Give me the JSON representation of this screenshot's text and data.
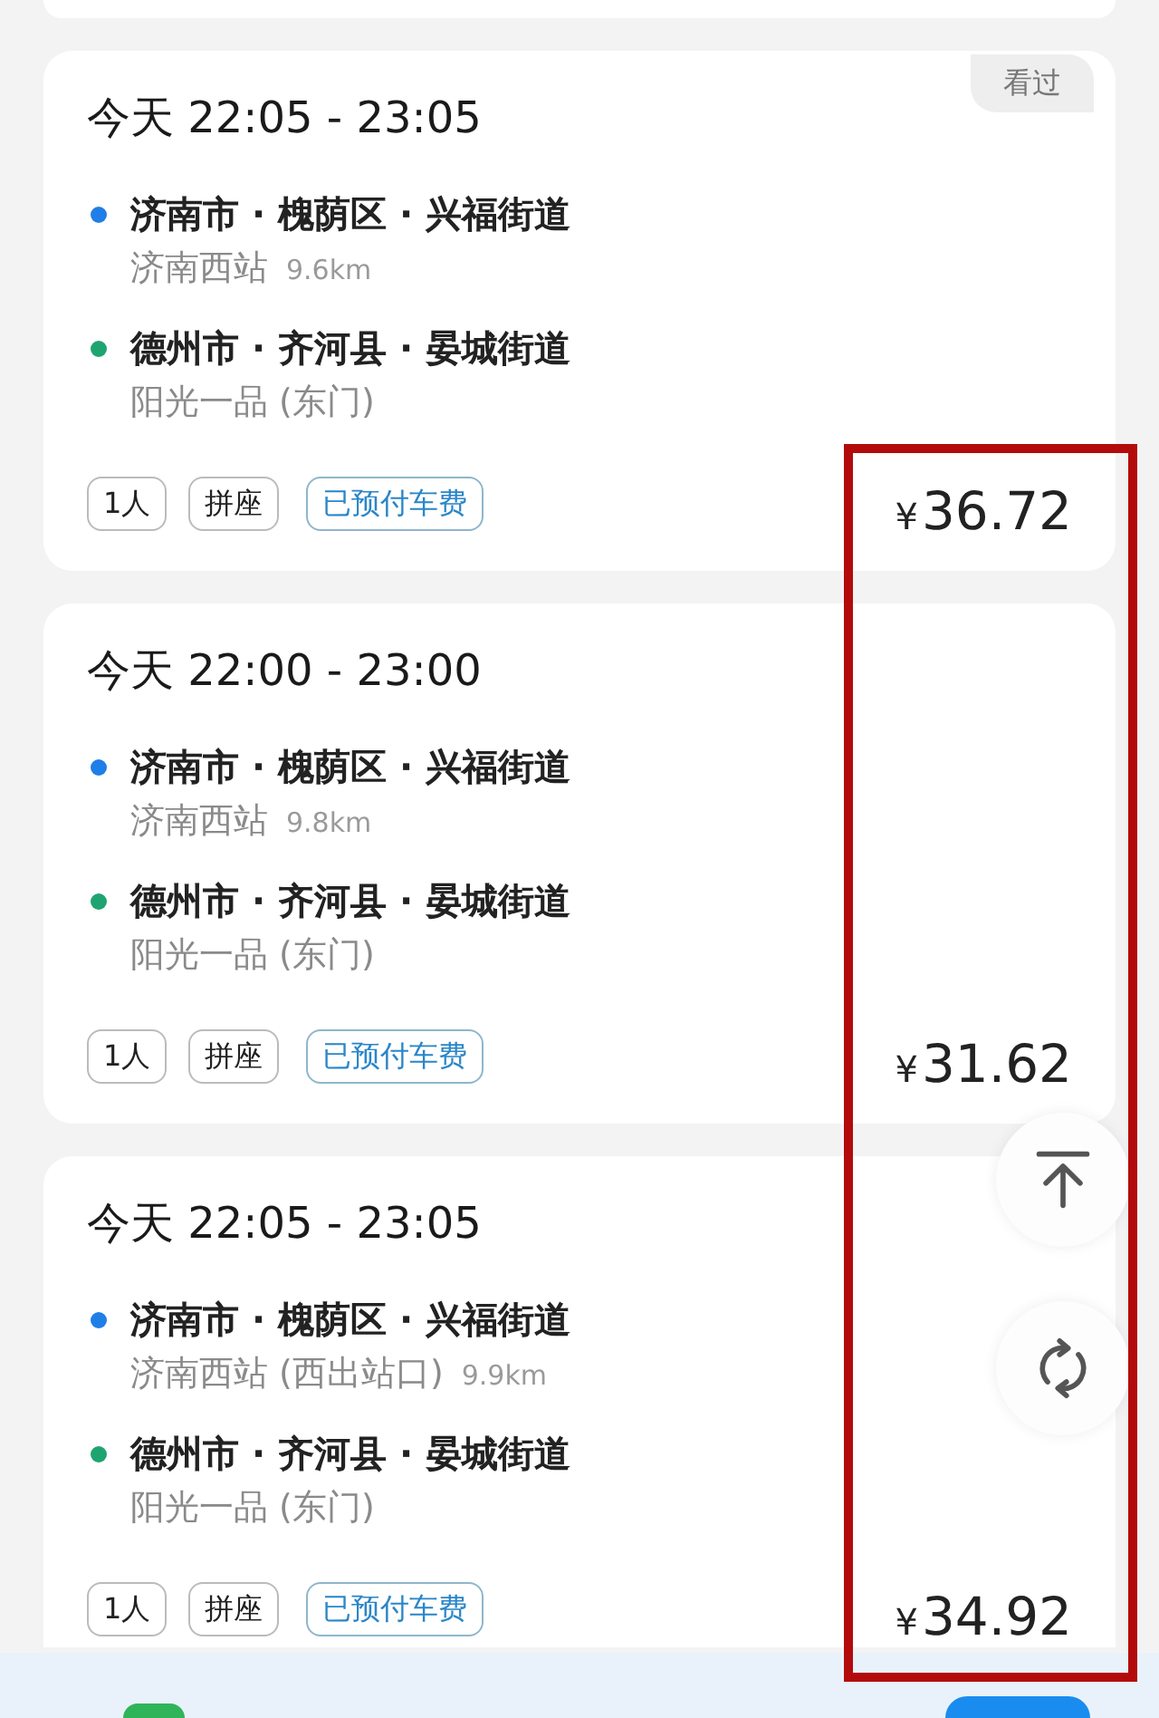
{
  "orders": [
    {
      "badge": "看过",
      "time": "今天 22:05 - 23:05",
      "stops": [
        {
          "color": "#1f7fe6",
          "address": "济南市 · 槐荫区 · 兴福街道",
          "place": "济南西站",
          "distance": "9.6km"
        },
        {
          "color": "#1fa471",
          "address": "德州市 · 齐河县 · 晏城街道",
          "place": "阳光一品 (东门)"
        }
      ],
      "tags": [
        {
          "kind": "plain",
          "label": "1人"
        },
        {
          "kind": "plain",
          "label": "拼座"
        },
        {
          "kind": "paid",
          "label": "已预付车费"
        }
      ],
      "price": {
        "currency": "¥",
        "amount": "36.72"
      }
    },
    {
      "time": "今天 22:00 - 23:00",
      "stops": [
        {
          "color": "#1f7fe6",
          "address": "济南市 · 槐荫区 · 兴福街道",
          "place": "济南西站",
          "distance": "9.8km"
        },
        {
          "color": "#1fa471",
          "address": "德州市 · 齐河县 · 晏城街道",
          "place": "阳光一品 (东门)"
        }
      ],
      "tags": [
        {
          "kind": "plain",
          "label": "1人"
        },
        {
          "kind": "plain",
          "label": "拼座"
        },
        {
          "kind": "paid",
          "label": "已预付车费"
        }
      ],
      "price": {
        "currency": "¥",
        "amount": "31.62"
      }
    },
    {
      "time": "今天 22:05 - 23:05",
      "stops": [
        {
          "color": "#1f7fe6",
          "address": "济南市 · 槐荫区 · 兴福街道",
          "place": "济南西站 (西出站口)",
          "distance": "9.9km"
        },
        {
          "color": "#1fa471",
          "address": "德州市 · 齐河县 · 晏城街道",
          "place": "阳光一品 (东门)"
        }
      ],
      "tags": [
        {
          "kind": "plain",
          "label": "1人"
        },
        {
          "kind": "plain",
          "label": "拼座"
        },
        {
          "kind": "paid",
          "label": "已预付车费"
        }
      ],
      "price": {
        "currency": "¥",
        "amount": "34.92"
      }
    }
  ],
  "floating_buttons": [
    {
      "kind": "back_to_top"
    },
    {
      "kind": "refresh"
    }
  ]
}
